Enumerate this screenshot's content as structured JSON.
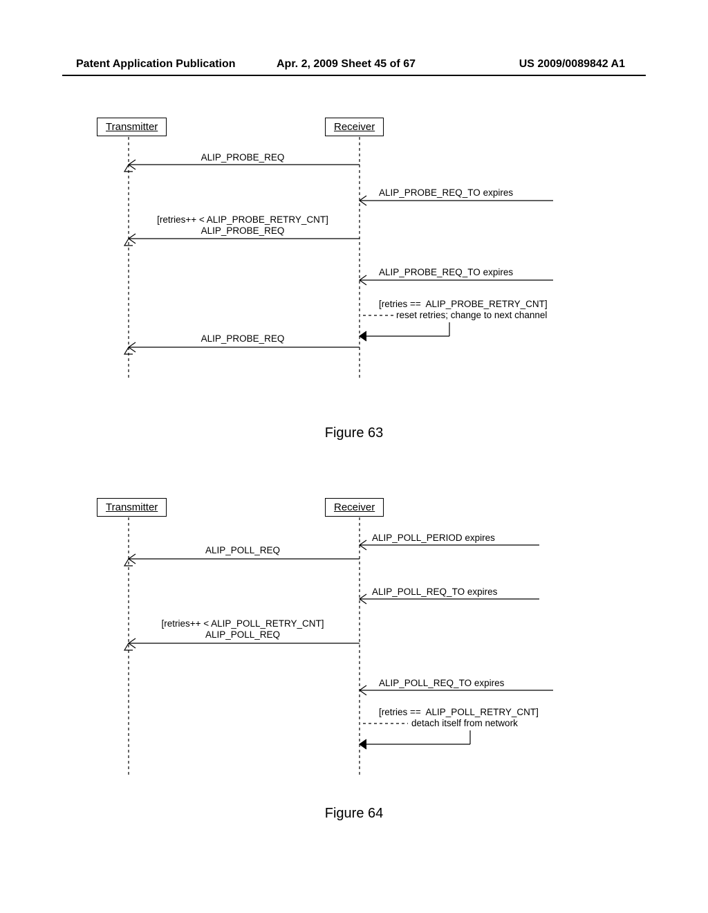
{
  "header": {
    "left": "Patent Application Publication",
    "center": "Apr. 2, 2009  Sheet 45 of 67",
    "right": "US 2009/0089842 A1"
  },
  "fig63": {
    "title": "Figure 63",
    "transmitter": "Transmitter",
    "receiver": "Receiver",
    "msg1": "ALIP_PROBE_REQ",
    "evt1": "ALIP_PROBE_REQ_TO expires",
    "msg2_guard": "[retries++ < ALIP_PROBE_RETRY_CNT]",
    "msg2": "ALIP_PROBE_REQ",
    "evt2": "ALIP_PROBE_REQ_TO expires",
    "self_guard": "[retries ==  ALIP_PROBE_RETRY_CNT]",
    "self_action": "reset retries; change to next channel",
    "msg3": "ALIP_PROBE_REQ"
  },
  "fig64": {
    "title": "Figure 64",
    "transmitter": "Transmitter",
    "receiver": "Receiver",
    "evt0": "ALIP_POLL_PERIOD expires",
    "msg1": "ALIP_POLL_REQ",
    "evt1": "ALIP_POLL_REQ_TO expires",
    "msg2_guard": "[retries++ < ALIP_POLL_RETRY_CNT]",
    "msg2": "ALIP_POLL_REQ",
    "evt2": "ALIP_POLL_REQ_TO expires",
    "self_guard": "[retries ==  ALIP_POLL_RETRY_CNT]",
    "self_action": "detach itself from network"
  }
}
